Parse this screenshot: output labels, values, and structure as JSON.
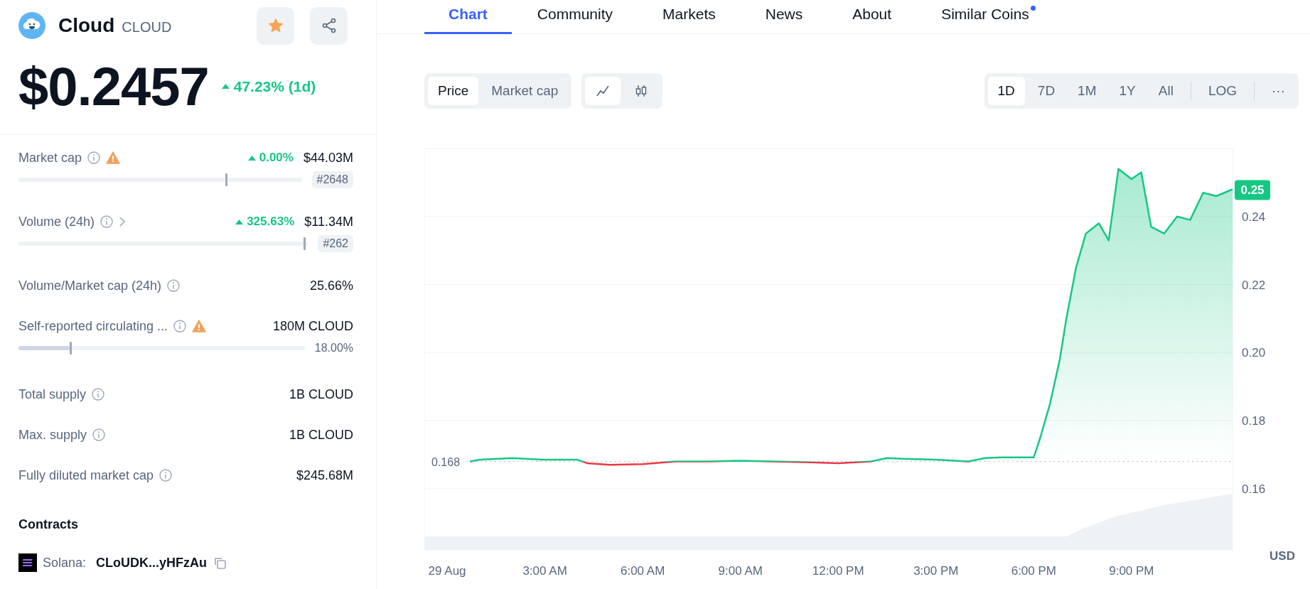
{
  "coin": {
    "name": "Cloud",
    "symbol": "CLOUD",
    "price": "$0.2457",
    "change": "47.23% (1d)",
    "favorite": true
  },
  "stats": [
    {
      "kind": "ranked",
      "label": "Market cap",
      "warning": true,
      "expandable": false,
      "change": "0.00%",
      "value": "$44.03M",
      "rank": "#2648",
      "level": 0.73
    },
    {
      "kind": "ranked",
      "label": "Volume (24h)",
      "warning": false,
      "expandable": true,
      "change": "325.63%",
      "value": "$11.34M",
      "rank": "#262",
      "level": 0.985
    },
    {
      "kind": "plain",
      "label": "Volume/Market cap (24h)",
      "warning": false,
      "expandable": false,
      "value": "25.66%"
    },
    {
      "kind": "progress",
      "label": "Self-reported circulating ...",
      "warning": true,
      "expandable": false,
      "value": "180M CLOUD",
      "percent": "18.00%",
      "level": 0.18
    },
    {
      "kind": "plain",
      "label": "Total supply",
      "warning": false,
      "expandable": false,
      "value": "1B CLOUD"
    },
    {
      "kind": "plain",
      "label": "Max. supply",
      "warning": false,
      "expandable": false,
      "value": "1B CLOUD"
    },
    {
      "kind": "plain",
      "label": "Fully diluted market cap",
      "warning": false,
      "expandable": false,
      "value": "$245.68M"
    }
  ],
  "contracts": {
    "title": "Contracts",
    "items": [
      {
        "chain": "Solana:",
        "address": "CLoUDK...yHFzAu"
      }
    ]
  },
  "tabs": [
    {
      "label": "Chart",
      "selected": true,
      "dot": false
    },
    {
      "label": "Community",
      "selected": false,
      "dot": false
    },
    {
      "label": "Markets",
      "selected": false,
      "dot": false
    },
    {
      "label": "News",
      "selected": false,
      "dot": false
    },
    {
      "label": "About",
      "selected": false,
      "dot": false
    },
    {
      "label": "Similar Coins",
      "selected": false,
      "dot": true
    }
  ],
  "metric_toggle": [
    {
      "label": "Price",
      "selected": true
    },
    {
      "label": "Market cap",
      "selected": false
    }
  ],
  "chart_type_toggle": [
    {
      "kind": "line",
      "selected": true
    },
    {
      "kind": "candles",
      "selected": false
    }
  ],
  "ranges": [
    {
      "label": "1D",
      "selected": true
    },
    {
      "label": "7D",
      "selected": false
    },
    {
      "label": "1M",
      "selected": false
    },
    {
      "label": "1Y",
      "selected": false
    },
    {
      "label": "All",
      "selected": false
    }
  ],
  "log_button": "LOG",
  "more_button": "···",
  "chart": {
    "chart_data": {
      "type": "area",
      "ylabel": "USD",
      "grid": true,
      "x": [
        0.7,
        1,
        2,
        3,
        4,
        4.3,
        5,
        6,
        7,
        8,
        9,
        10,
        11,
        12,
        13,
        13.5,
        14,
        15,
        16,
        16.5,
        17,
        18,
        18.2,
        18.5,
        18.8,
        19,
        19.3,
        19.6,
        20,
        20.3,
        20.6,
        21,
        21.3,
        21.6,
        22,
        22.4,
        22.8,
        23.2,
        23.6,
        24.1
      ],
      "series": [
        {
          "color": "#16c784",
          "values": [
            0.168,
            0.1685,
            0.169,
            0.1685,
            0.1685,
            0.1675,
            0.167,
            0.1672,
            0.168,
            0.168,
            0.1682,
            0.168,
            0.1678,
            0.1675,
            0.168,
            0.169,
            0.1688,
            0.1685,
            0.168,
            0.169,
            0.1692,
            0.1692,
            0.175,
            0.185,
            0.198,
            0.21,
            0.225,
            0.235,
            0.238,
            0.233,
            0.254,
            0.251,
            0.253,
            0.237,
            0.235,
            0.24,
            0.239,
            0.247,
            0.246,
            0.248
          ]
        }
      ],
      "xlim": [
        -0.7,
        24.1
      ],
      "ylim": [
        0.142,
        0.26
      ],
      "xticks": [
        {
          "value": 0,
          "label": "29 Aug"
        },
        {
          "value": 3,
          "label": "3:00 AM"
        },
        {
          "value": 6,
          "label": "6:00 AM"
        },
        {
          "value": 9,
          "label": "9:00 AM"
        },
        {
          "value": 12,
          "label": "12:00 PM"
        },
        {
          "value": 15,
          "label": "3:00 PM"
        },
        {
          "value": 18,
          "label": "6:00 PM"
        },
        {
          "value": 21,
          "label": "9:00 PM"
        }
      ],
      "yticks": [
        {
          "value": 0.16,
          "label": "0.16"
        },
        {
          "value": 0.18,
          "label": "0.18"
        },
        {
          "value": 0.2,
          "label": "0.20"
        },
        {
          "value": 0.22,
          "label": "0.22"
        },
        {
          "value": 0.24,
          "label": "0.24"
        }
      ],
      "ref_lines": [
        {
          "axis": "y",
          "value": 0.168,
          "label": "0.168"
        }
      ],
      "annotations": [
        {
          "text": "0.25",
          "x": 24.1,
          "y": 0.248
        }
      ]
    }
  }
}
